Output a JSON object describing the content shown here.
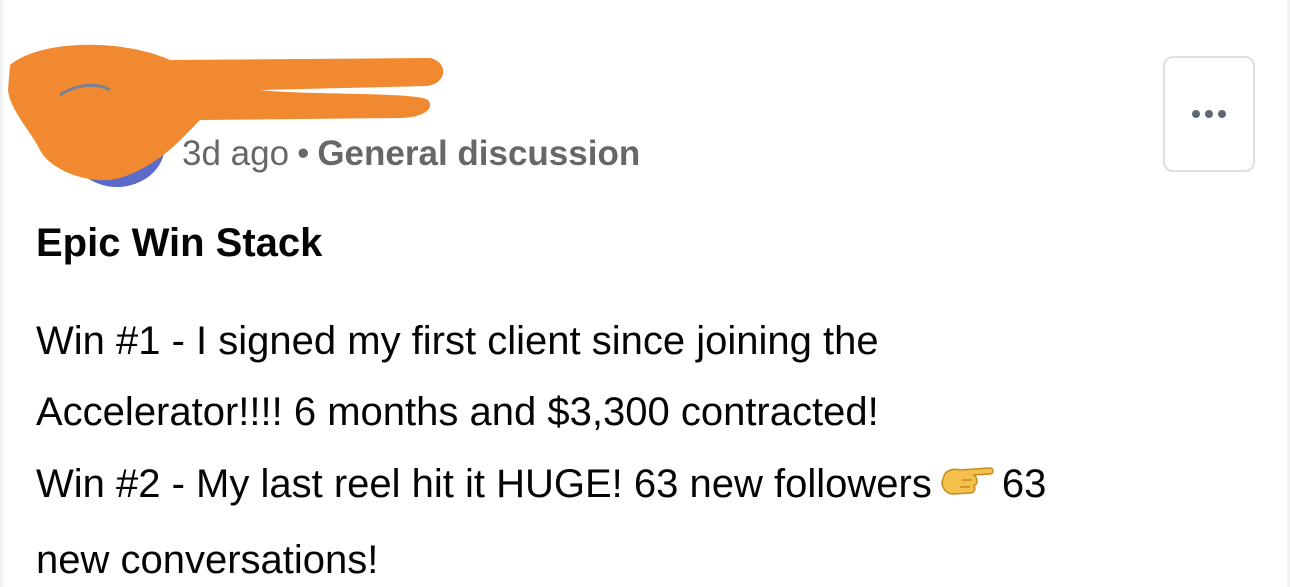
{
  "post": {
    "meta_time": "3d ago",
    "meta_separator": "•",
    "meta_category": "General discussion",
    "title": "Epic Win Stack",
    "body_lines": [
      "Win #1 - I signed my first client since joining the",
      "Accelerator!!!! 6 months and $3,300 contracted!",
      "Win #2 - My last reel hit it HUGE! 63 new followers",
      "63",
      "new conversations!"
    ]
  },
  "icons": {
    "more": "more-horizontal-icon",
    "pointing": "pointing-right-hand-icon"
  },
  "colors": {
    "redaction": "#f0892f",
    "meta_text": "#65676b",
    "body_text": "#050505",
    "avatar": "#5a6bc9"
  }
}
